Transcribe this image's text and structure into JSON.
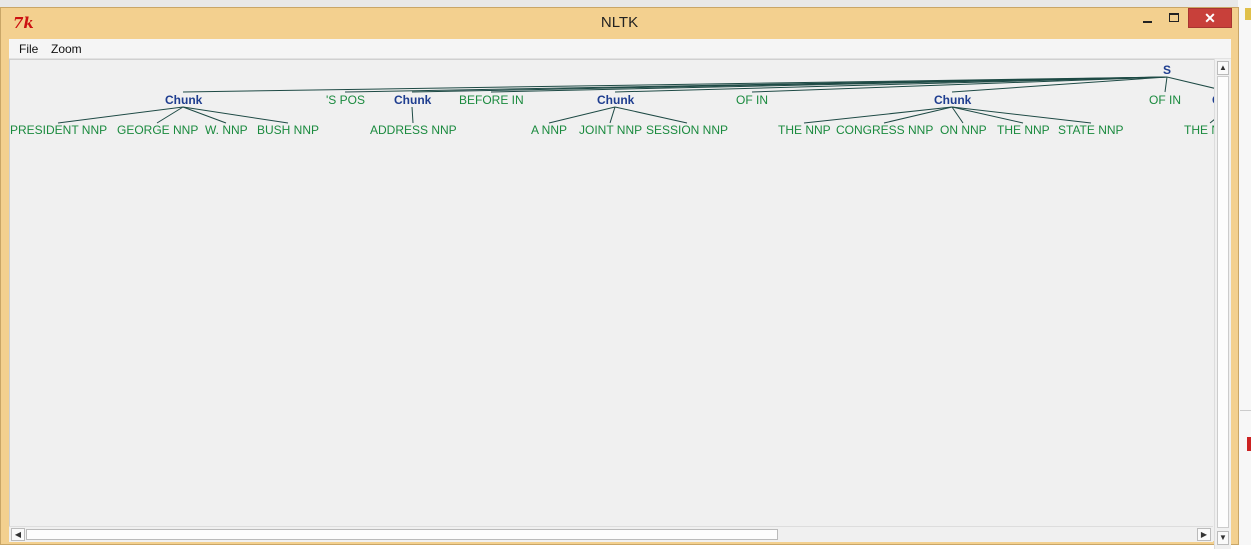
{
  "window": {
    "title": "NLTK",
    "icon_label": "7k",
    "close_glyph": "✕",
    "menu": [
      {
        "label": "File"
      },
      {
        "label": "Zoom"
      }
    ]
  },
  "tree": {
    "root": "S",
    "nodes": [
      {
        "label": "Chunk",
        "type": "phrase",
        "children": [
          {
            "label": "PRESIDENT NNP"
          },
          {
            "label": "GEORGE NNP"
          },
          {
            "label": "W. NNP"
          },
          {
            "label": "BUSH NNP"
          }
        ]
      },
      {
        "label": "'S POS",
        "type": "leaf"
      },
      {
        "label": "Chunk",
        "type": "phrase",
        "children": [
          {
            "label": "ADDRESS NNP"
          }
        ]
      },
      {
        "label": "BEFORE IN",
        "type": "leaf"
      },
      {
        "label": "Chunk",
        "type": "phrase",
        "children": [
          {
            "label": "A NNP"
          },
          {
            "label": "JOINT NNP"
          },
          {
            "label": "SESSION NNP"
          }
        ]
      },
      {
        "label": "OF IN",
        "type": "leaf"
      },
      {
        "label": "Chunk",
        "type": "phrase",
        "children": [
          {
            "label": "THE NNP"
          },
          {
            "label": "CONGRESS NNP"
          },
          {
            "label": "ON NNP"
          },
          {
            "label": "THE NNP"
          },
          {
            "label": "STATE NNP"
          }
        ]
      },
      {
        "label": "OF IN",
        "type": "leaf"
      },
      {
        "label": "Chunk",
        "type": "phrase",
        "children": [
          {
            "label": "THE NNP"
          }
        ]
      }
    ]
  },
  "scrollbars": {
    "up": "▲",
    "down": "▼",
    "left": "◀",
    "right": "▶"
  },
  "colors": {
    "phrase": "#1e3d8f",
    "leaf": "#1a8a3e",
    "edge": "#1e4a45",
    "title_bar": "#f3d08f",
    "close_button": "#c8403a"
  }
}
